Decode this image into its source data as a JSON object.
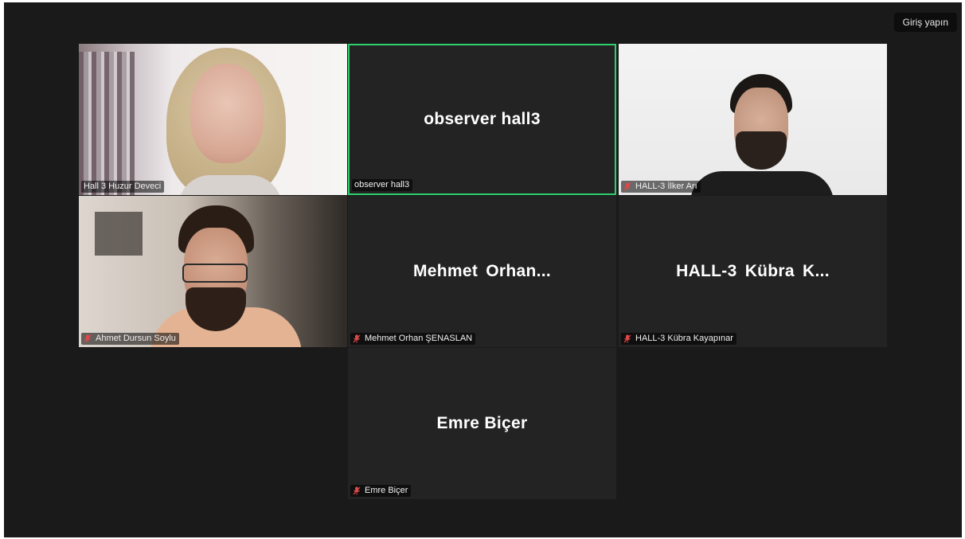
{
  "app": {
    "signin_label": "Giriş yapın"
  },
  "colors": {
    "background": "#1a1a1a",
    "tile": "#232323",
    "active_speaker_border": "#2fcf6e",
    "mute_icon": "#e04848"
  },
  "participants": [
    {
      "label": "Hall 3 Huzur Deveci",
      "display_name": "",
      "video": true,
      "muted": false,
      "active": false
    },
    {
      "label": "observer hall3",
      "display_name": "observer hall3",
      "video": false,
      "muted": false,
      "active": true
    },
    {
      "label": "HALL-3 İlker Arı",
      "display_name": "",
      "video": true,
      "muted": true,
      "active": false
    },
    {
      "label": "Ahmet Dursun Soylu",
      "display_name": "",
      "video": true,
      "muted": true,
      "active": false
    },
    {
      "label": "Mehmet Orhan ŞENASLAN",
      "display_name": "Mehmet Orhan...",
      "video": false,
      "muted": true,
      "active": false
    },
    {
      "label": "HALL-3 Kübra Kayapınar",
      "display_name": "HALL-3 Kübra K...",
      "video": false,
      "muted": true,
      "active": false
    },
    {
      "label": "Emre Biçer",
      "display_name": "Emre Biçer",
      "video": false,
      "muted": true,
      "active": false
    }
  ]
}
